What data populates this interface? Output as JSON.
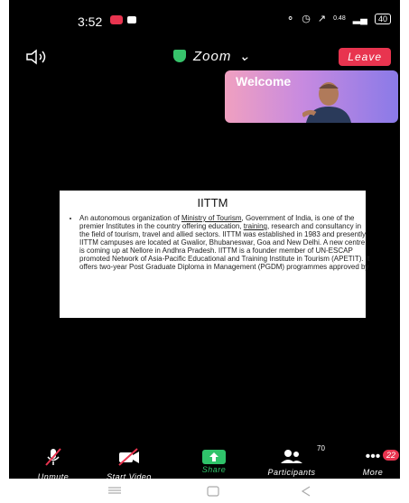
{
  "status_bar": {
    "time": "3:52",
    "network_speed": "0.48",
    "battery": "40"
  },
  "header": {
    "app_title": "Zoom",
    "leave_label": "Leave"
  },
  "video_thumbnail": {
    "label": "Welcome"
  },
  "slide": {
    "title": "IITTM",
    "text_part1": "An autonomous organization of ",
    "link1": "Ministry of Tourism",
    "text_part2": ", Government of India, is one of the premier Institutes in the country offering education, ",
    "link2": "training",
    "text_part3": ", research and consultancy in the field of tourism, travel and allied sectors. IITTM was established in 1983 and presently IITTM campuses are located at Gwalior, Bhubaneswar, Goa and New Delhi. A new centre is coming up at Nellore in Andhra Pradesh. IITTM is a founder member of UN-ESCAP promoted Network of Asia-Pacific Educational and Training Institute in Tourism (APETIT). It offers two-year Post Graduate Diploma in Management (PGDM) programmes approved by"
  },
  "toolbar": {
    "unmute": "Unmute",
    "start_video": "Start Video",
    "share": "Share",
    "participants": "Participants",
    "participants_count": "70",
    "more": "More",
    "more_badge": "22"
  },
  "colors": {
    "accent_red": "#e8344f",
    "share_green": "#2fc36a"
  }
}
